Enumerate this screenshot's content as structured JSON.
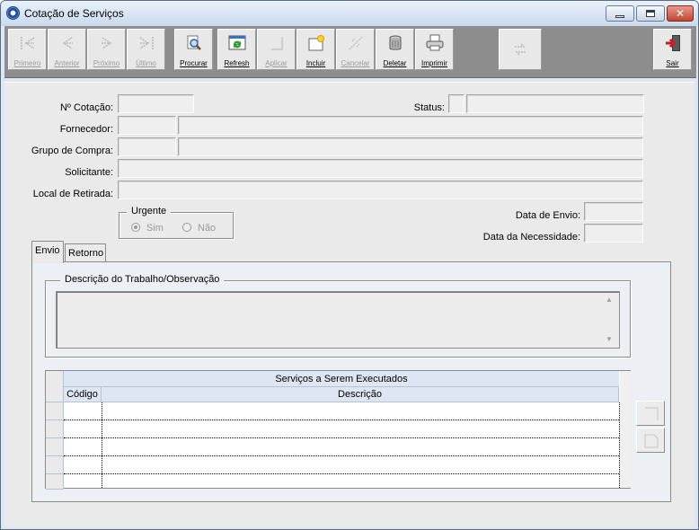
{
  "window": {
    "title": "Cotação de Serviços"
  },
  "toolbar": {
    "buttons": [
      {
        "id": "primeiro",
        "label": "Primeiro",
        "icon": "first-record-icon",
        "enabled": false
      },
      {
        "id": "anterior",
        "label": "Anterior",
        "icon": "prior-record-icon",
        "enabled": false
      },
      {
        "id": "proximo",
        "label": "Próximo",
        "icon": "next-record-icon",
        "enabled": false
      },
      {
        "id": "ultimo",
        "label": "Último",
        "icon": "last-record-icon",
        "enabled": false
      },
      {
        "id": "procurar",
        "label": "Procurar",
        "icon": "search-icon",
        "enabled": true
      },
      {
        "id": "refresh",
        "label": "Refresh",
        "icon": "refresh-icon",
        "enabled": true
      },
      {
        "id": "aplicar",
        "label": "Aplicar",
        "icon": "apply-icon",
        "enabled": false
      },
      {
        "id": "incluir",
        "label": "Incluir",
        "icon": "add-icon",
        "enabled": true
      },
      {
        "id": "cancelar",
        "label": "Cancelar",
        "icon": "cancel-icon",
        "enabled": false
      },
      {
        "id": "deletar",
        "label": "Deletar",
        "icon": "trash-icon",
        "enabled": true
      },
      {
        "id": "imprimir",
        "label": "Imprimir",
        "icon": "printer-icon",
        "enabled": true
      },
      {
        "id": "sair",
        "label": "Sair",
        "icon": "exit-door-icon",
        "enabled": true
      }
    ]
  },
  "form": {
    "num_cotacao_label": "Nº Cotação:",
    "status_label": "Status:",
    "fornecedor_label": "Fornecedor:",
    "grupo_compra_label": "Grupo de Compra:",
    "solicitante_label": "Solicitante:",
    "local_retirada_label": "Local de Retirada:",
    "urgente": {
      "title": "Urgente",
      "sim": "Sim",
      "nao": "Não",
      "selected": "Sim"
    },
    "data_envio_label": "Data de Envio:",
    "data_necessidade_label": "Data da Necessidade:"
  },
  "tabs": [
    {
      "label": "Envio",
      "active": true
    },
    {
      "label": "Retorno",
      "active": false
    }
  ],
  "envio": {
    "descricao_title": "Descrição do Trabalho/Observação",
    "grid": {
      "title": "Serviços a Serem Executados",
      "columns": [
        "Código",
        "Descrição"
      ],
      "rows": []
    }
  },
  "colors": {
    "window_bg": "#dce7f3",
    "toolbar_bg": "#8d8d8d",
    "panel_bg": "#eaeaea",
    "grid_header_bg": "#dde6f2",
    "close_button": "#c24631"
  }
}
